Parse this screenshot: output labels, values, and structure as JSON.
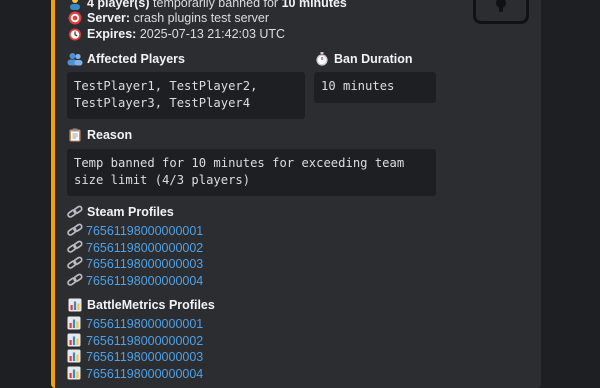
{
  "header": {
    "players_prefix": "4 player(s)",
    "players_middle": "temporarily banned for",
    "players_duration": "10 minutes",
    "server_label": "Server:",
    "server_value": "crash plugins test server",
    "expires_label": "Expires:",
    "expires_value": "2025-07-13 21:42:03 UTC"
  },
  "fields": {
    "affected_title": "Affected Players",
    "affected_value": "TestPlayer1, TestPlayer2,\nTestPlayer3, TestPlayer4",
    "duration_title": "Ban Duration",
    "duration_value": "10 minutes",
    "reason_title": "Reason",
    "reason_value": "Temp banned for 10 minutes for exceeding team\nsize limit (4/3 players)"
  },
  "steam": {
    "title": "Steam Profiles",
    "links": [
      "76561198000000001",
      "76561198000000002",
      "76561198000000003",
      "76561198000000004"
    ]
  },
  "battlemetrics": {
    "title": "BattleMetrics Profiles",
    "links": [
      "76561198000000001",
      "76561198000000002",
      "76561198000000003",
      "76561198000000004"
    ]
  },
  "icons": {
    "header": "user-ban-icon",
    "server": "target-icon",
    "expires": "alarm-clock-icon",
    "affected": "users-icon",
    "duration": "stopwatch-icon",
    "reason": "clipboard-icon",
    "steam": "link-icon",
    "battlemetrics": "bar-chart-icon",
    "thumbnail": "lock-icon"
  },
  "colors": {
    "accent_bar": "#f0a20c",
    "link": "#4ea1e6",
    "embed_bg": "#2b2d31",
    "page_bg": "#1e1f22"
  }
}
